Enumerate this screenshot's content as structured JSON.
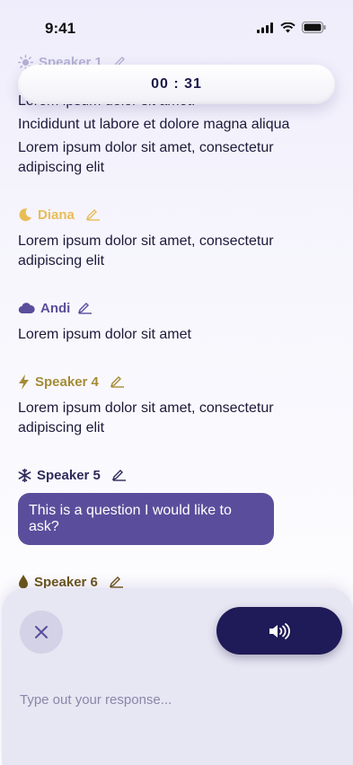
{
  "status": {
    "time": "9:41"
  },
  "timer": {
    "value": "00 : 31"
  },
  "transcript": [
    {
      "speaker": "Speaker 1",
      "icon": "sun-icon",
      "color": "#9c98c4",
      "lines": [
        "Lorem ipsum dolor sit amet.",
        "Incididunt ut labore et dolore magna aliqua",
        "Lorem ipsum dolor sit amet, consectetur adipiscing elit"
      ]
    },
    {
      "speaker": "Diana",
      "icon": "moon-icon",
      "color": "#e8bd55",
      "lines": [
        "Lorem ipsum dolor sit amet, consectetur adipiscing elit"
      ]
    },
    {
      "speaker": "Andi",
      "icon": "cloud-icon",
      "color": "#5a4e9c",
      "lines": [
        "Lorem ipsum dolor sit amet"
      ]
    },
    {
      "speaker": "Speaker 4",
      "icon": "lightning-icon",
      "color": "#a48c35",
      "lines": [
        "Lorem ipsum dolor sit amet, consectetur adipiscing elit"
      ]
    },
    {
      "speaker": "Speaker 5",
      "icon": "snowflake-icon",
      "color": "#2e2a5c",
      "question": "This is a question I would like to ask?"
    },
    {
      "speaker": "Speaker 6",
      "icon": "droplet-icon",
      "color": "#6b5419"
    }
  ],
  "bottom": {
    "placeholder": "Type out your response...",
    "close_icon": "close-icon",
    "speaker_icon": "speaker-volume-icon"
  }
}
